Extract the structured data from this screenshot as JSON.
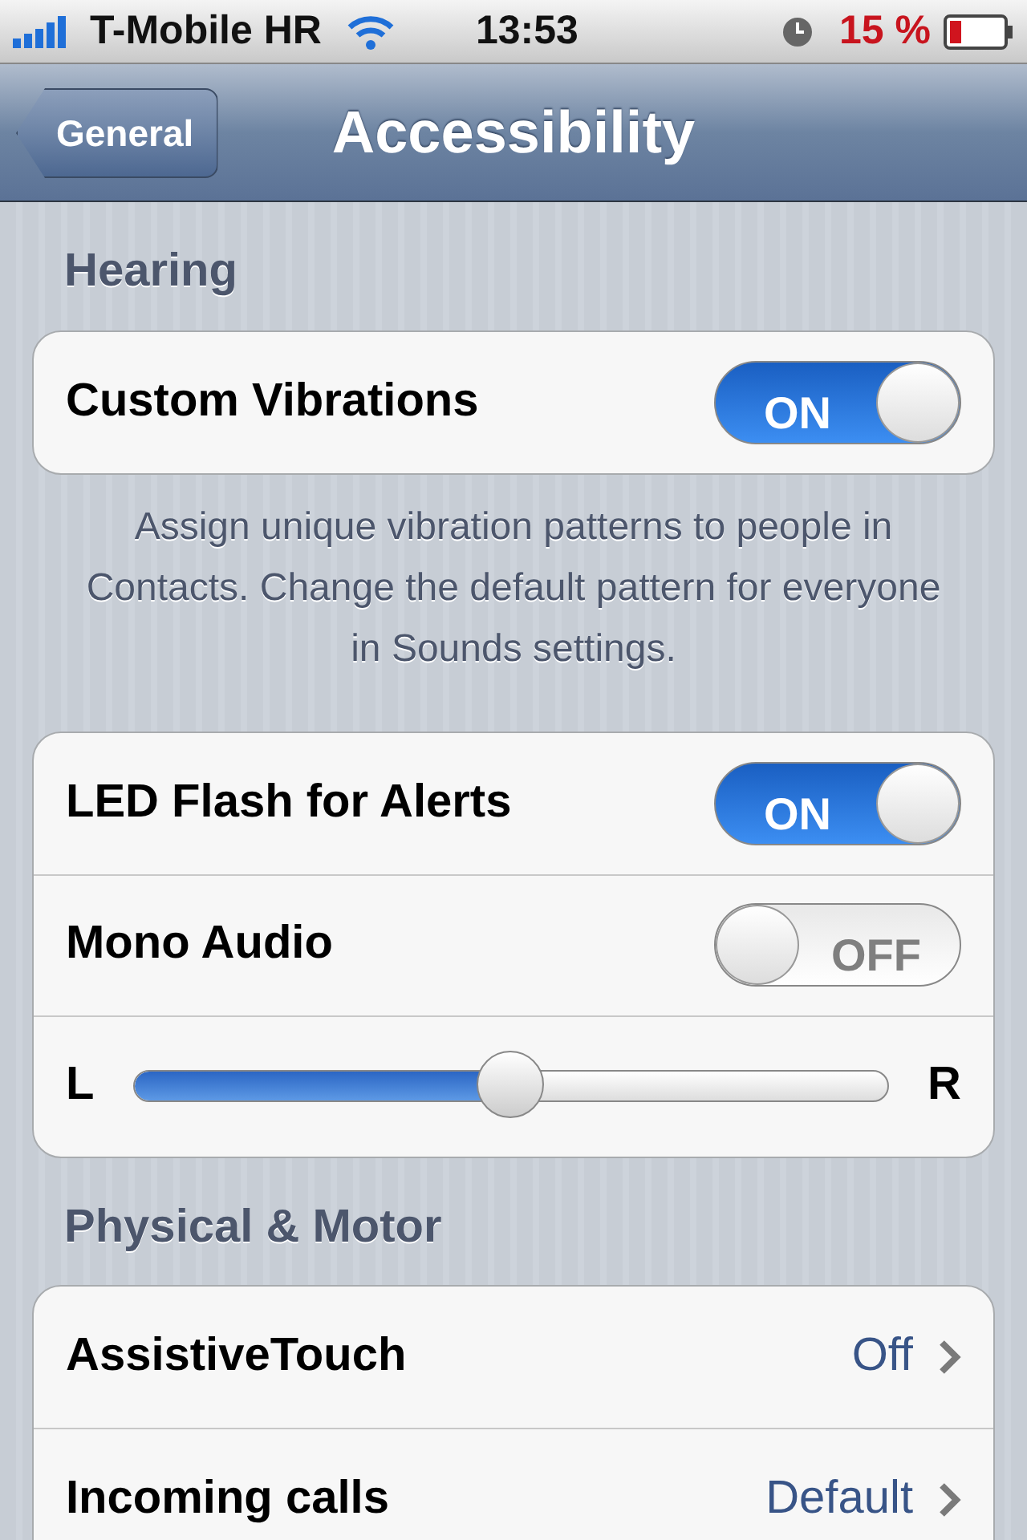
{
  "status_bar": {
    "carrier": "T-Mobile HR",
    "time": "13:53",
    "battery": "15 %"
  },
  "nav_bar": {
    "back": "General",
    "title": "Accessibility"
  },
  "sections": [
    {
      "header": "Hearing",
      "rows": [
        {
          "kind": "toggle",
          "label": "Custom Vibrations",
          "state_text": "ON",
          "on": true
        }
      ],
      "footer": "Assign unique vibration patterns to people in Contacts. Change the default pattern for everyone in Sounds settings."
    },
    {
      "rows": [
        {
          "kind": "toggle",
          "label": "LED Flash for Alerts",
          "state_text": "ON",
          "on": true
        },
        {
          "kind": "toggle",
          "label": "Mono Audio",
          "state_text": "OFF",
          "on": false
        },
        {
          "kind": "slider",
          "left": "L",
          "right": "R",
          "level": 0.5
        }
      ]
    },
    {
      "header": "Physical & Motor",
      "rows": [
        {
          "kind": "disclosure",
          "label": "AssistiveTouch",
          "value": "Off"
        },
        {
          "kind": "disclosure",
          "label": "Incoming calls",
          "value": "Default"
        }
      ]
    }
  ]
}
